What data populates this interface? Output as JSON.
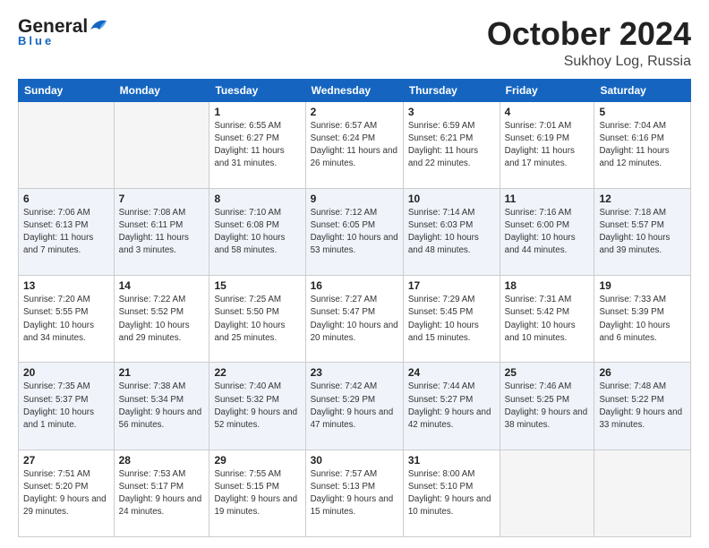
{
  "header": {
    "logo_general": "General",
    "logo_blue": "Blue",
    "title": "October 2024",
    "location": "Sukhoy Log, Russia"
  },
  "calendar": {
    "days_of_week": [
      "Sunday",
      "Monday",
      "Tuesday",
      "Wednesday",
      "Thursday",
      "Friday",
      "Saturday"
    ],
    "weeks": [
      [
        {
          "day": "",
          "info": ""
        },
        {
          "day": "",
          "info": ""
        },
        {
          "day": "1",
          "info": "Sunrise: 6:55 AM\nSunset: 6:27 PM\nDaylight: 11 hours\nand 31 minutes."
        },
        {
          "day": "2",
          "info": "Sunrise: 6:57 AM\nSunset: 6:24 PM\nDaylight: 11 hours\nand 26 minutes."
        },
        {
          "day": "3",
          "info": "Sunrise: 6:59 AM\nSunset: 6:21 PM\nDaylight: 11 hours\nand 22 minutes."
        },
        {
          "day": "4",
          "info": "Sunrise: 7:01 AM\nSunset: 6:19 PM\nDaylight: 11 hours\nand 17 minutes."
        },
        {
          "day": "5",
          "info": "Sunrise: 7:04 AM\nSunset: 6:16 PM\nDaylight: 11 hours\nand 12 minutes."
        }
      ],
      [
        {
          "day": "6",
          "info": "Sunrise: 7:06 AM\nSunset: 6:13 PM\nDaylight: 11 hours\nand 7 minutes."
        },
        {
          "day": "7",
          "info": "Sunrise: 7:08 AM\nSunset: 6:11 PM\nDaylight: 11 hours\nand 3 minutes."
        },
        {
          "day": "8",
          "info": "Sunrise: 7:10 AM\nSunset: 6:08 PM\nDaylight: 10 hours\nand 58 minutes."
        },
        {
          "day": "9",
          "info": "Sunrise: 7:12 AM\nSunset: 6:05 PM\nDaylight: 10 hours\nand 53 minutes."
        },
        {
          "day": "10",
          "info": "Sunrise: 7:14 AM\nSunset: 6:03 PM\nDaylight: 10 hours\nand 48 minutes."
        },
        {
          "day": "11",
          "info": "Sunrise: 7:16 AM\nSunset: 6:00 PM\nDaylight: 10 hours\nand 44 minutes."
        },
        {
          "day": "12",
          "info": "Sunrise: 7:18 AM\nSunset: 5:57 PM\nDaylight: 10 hours\nand 39 minutes."
        }
      ],
      [
        {
          "day": "13",
          "info": "Sunrise: 7:20 AM\nSunset: 5:55 PM\nDaylight: 10 hours\nand 34 minutes."
        },
        {
          "day": "14",
          "info": "Sunrise: 7:22 AM\nSunset: 5:52 PM\nDaylight: 10 hours\nand 29 minutes."
        },
        {
          "day": "15",
          "info": "Sunrise: 7:25 AM\nSunset: 5:50 PM\nDaylight: 10 hours\nand 25 minutes."
        },
        {
          "day": "16",
          "info": "Sunrise: 7:27 AM\nSunset: 5:47 PM\nDaylight: 10 hours\nand 20 minutes."
        },
        {
          "day": "17",
          "info": "Sunrise: 7:29 AM\nSunset: 5:45 PM\nDaylight: 10 hours\nand 15 minutes."
        },
        {
          "day": "18",
          "info": "Sunrise: 7:31 AM\nSunset: 5:42 PM\nDaylight: 10 hours\nand 10 minutes."
        },
        {
          "day": "19",
          "info": "Sunrise: 7:33 AM\nSunset: 5:39 PM\nDaylight: 10 hours\nand 6 minutes."
        }
      ],
      [
        {
          "day": "20",
          "info": "Sunrise: 7:35 AM\nSunset: 5:37 PM\nDaylight: 10 hours\nand 1 minute."
        },
        {
          "day": "21",
          "info": "Sunrise: 7:38 AM\nSunset: 5:34 PM\nDaylight: 9 hours\nand 56 minutes."
        },
        {
          "day": "22",
          "info": "Sunrise: 7:40 AM\nSunset: 5:32 PM\nDaylight: 9 hours\nand 52 minutes."
        },
        {
          "day": "23",
          "info": "Sunrise: 7:42 AM\nSunset: 5:29 PM\nDaylight: 9 hours\nand 47 minutes."
        },
        {
          "day": "24",
          "info": "Sunrise: 7:44 AM\nSunset: 5:27 PM\nDaylight: 9 hours\nand 42 minutes."
        },
        {
          "day": "25",
          "info": "Sunrise: 7:46 AM\nSunset: 5:25 PM\nDaylight: 9 hours\nand 38 minutes."
        },
        {
          "day": "26",
          "info": "Sunrise: 7:48 AM\nSunset: 5:22 PM\nDaylight: 9 hours\nand 33 minutes."
        }
      ],
      [
        {
          "day": "27",
          "info": "Sunrise: 7:51 AM\nSunset: 5:20 PM\nDaylight: 9 hours\nand 29 minutes."
        },
        {
          "day": "28",
          "info": "Sunrise: 7:53 AM\nSunset: 5:17 PM\nDaylight: 9 hours\nand 24 minutes."
        },
        {
          "day": "29",
          "info": "Sunrise: 7:55 AM\nSunset: 5:15 PM\nDaylight: 9 hours\nand 19 minutes."
        },
        {
          "day": "30",
          "info": "Sunrise: 7:57 AM\nSunset: 5:13 PM\nDaylight: 9 hours\nand 15 minutes."
        },
        {
          "day": "31",
          "info": "Sunrise: 8:00 AM\nSunset: 5:10 PM\nDaylight: 9 hours\nand 10 minutes."
        },
        {
          "day": "",
          "info": ""
        },
        {
          "day": "",
          "info": ""
        }
      ]
    ]
  }
}
